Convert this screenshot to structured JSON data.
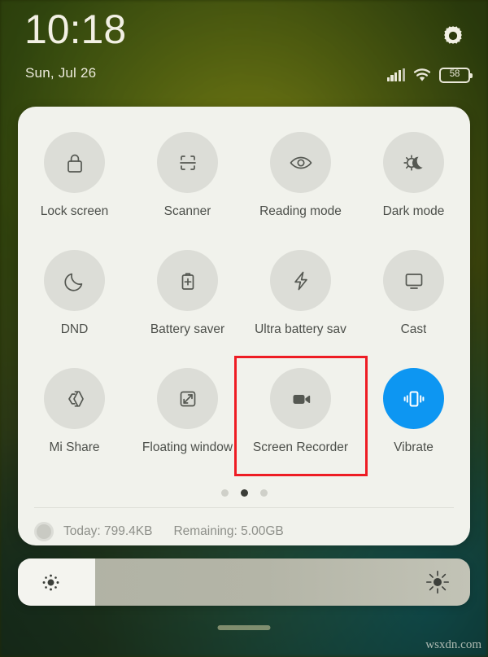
{
  "statusbar": {
    "time": "10:18",
    "date": "Sun, Jul 26",
    "battery_percent": "58",
    "gear_icon": "gear-icon",
    "signal_icon": "signal-bars-icon",
    "wifi_icon": "wifi-icon",
    "battery_icon": "battery-icon"
  },
  "quick_settings": {
    "tiles": [
      {
        "label": "Lock screen",
        "icon": "lock-icon",
        "active": false
      },
      {
        "label": "Scanner",
        "icon": "scanner-icon",
        "active": false
      },
      {
        "label": "Reading mode",
        "icon": "eye-icon",
        "active": false
      },
      {
        "label": "Dark mode",
        "icon": "sun-moon-icon",
        "active": false
      },
      {
        "label": "DND",
        "icon": "moon-icon",
        "active": false
      },
      {
        "label": "Battery saver",
        "icon": "battery-plus-icon",
        "active": false
      },
      {
        "label": "Ultra battery sav",
        "icon": "lightning-bolt-icon",
        "active": false
      },
      {
        "label": "Cast",
        "icon": "monitor-icon",
        "active": false
      },
      {
        "label": "Mi Share",
        "icon": "mi-share-icon",
        "active": false
      },
      {
        "label": "Floating window",
        "icon": "floating-window-icon",
        "active": false
      },
      {
        "label": "Screen Recorder",
        "icon": "video-camera-icon",
        "active": false
      },
      {
        "label": "Vibrate",
        "icon": "vibrate-icon",
        "active": true
      }
    ],
    "pager": {
      "count": 3,
      "active_index": 1
    },
    "data_usage": {
      "today_label": "Today: 799.4KB",
      "remaining_label": "Remaining: 5.00GB"
    }
  },
  "brightness": {
    "level_percent": 17,
    "low_icon": "brightness-low-icon",
    "high_icon": "brightness-high-icon"
  },
  "annotation": {
    "highlight_target": "Screen Recorder",
    "color": "#ee1c24"
  },
  "watermark": "wsxdn.com",
  "colors": {
    "panel_bg": "#f1f2ec",
    "tile_bg": "#dcddd7",
    "tile_active_bg": "#0d96f2",
    "label_text": "#4c4f4a",
    "muted_text": "#8d8f89",
    "status_text": "#f2f0e4"
  }
}
